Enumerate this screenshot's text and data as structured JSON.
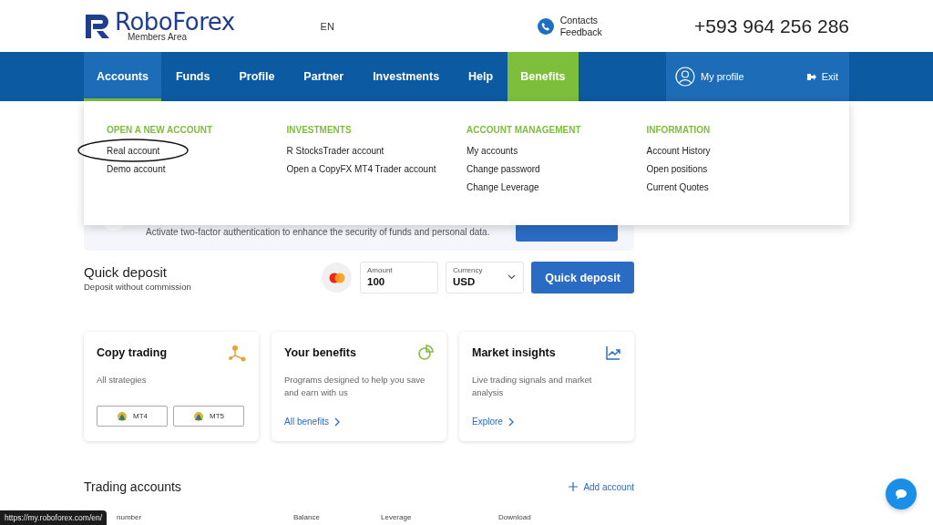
{
  "header": {
    "brand": "RoboForex",
    "subtitle": "Members Area",
    "language": "EN",
    "contacts": [
      "Contacts",
      "Feedback"
    ],
    "phone": "+593 964 256 286"
  },
  "nav": {
    "items": [
      {
        "label": "Accounts",
        "selected": true,
        "accent": false
      },
      {
        "label": "Funds",
        "selected": false,
        "accent": false
      },
      {
        "label": "Profile",
        "selected": false,
        "accent": false
      },
      {
        "label": "Partner",
        "selected": false,
        "accent": false
      },
      {
        "label": "Investments",
        "selected": false,
        "accent": false
      },
      {
        "label": "Help",
        "selected": false,
        "accent": false
      },
      {
        "label": "Benefits",
        "selected": false,
        "accent": true
      }
    ],
    "profile": "My profile",
    "exit": "Exit"
  },
  "dropdown": {
    "columns": [
      {
        "heading": "OPEN A NEW ACCOUNT",
        "links": [
          {
            "label": "Real account",
            "circled": true
          },
          {
            "label": "Demo account",
            "circled": false
          }
        ]
      },
      {
        "heading": "INVESTMENTS",
        "links": [
          {
            "label": "R StocksTrader account",
            "circled": false
          },
          {
            "label": "Open a CopyFX MT4 Trader account",
            "circled": false
          }
        ]
      },
      {
        "heading": "ACCOUNT MANAGEMENT",
        "links": [
          {
            "label": "My accounts",
            "circled": false
          },
          {
            "label": "Change password",
            "circled": false
          },
          {
            "label": "Change Leverage",
            "circled": false
          }
        ]
      },
      {
        "heading": "INFORMATION",
        "links": [
          {
            "label": "Account History",
            "circled": false
          },
          {
            "label": "Open positions",
            "circled": false
          },
          {
            "label": "Current Quotes",
            "circled": false
          }
        ]
      }
    ]
  },
  "security_banner": {
    "text": "Activate two-factor authentication to enhance the security of funds and personal data."
  },
  "quick_deposit": {
    "title": "Quick deposit",
    "subtitle": "Deposit without commission",
    "amount": {
      "label": "Amount",
      "value": "100"
    },
    "currency": {
      "label": "Currency",
      "value": "USD"
    },
    "button": "Quick deposit"
  },
  "cards": [
    {
      "kind": "copy",
      "title": "Copy trading",
      "text": "All strategies",
      "buttons": [
        "MT4",
        "MT5"
      ]
    },
    {
      "kind": "benefits",
      "title": "Your benefits",
      "text": "Programs designed to help you save and earn with us",
      "link": "All benefits"
    },
    {
      "kind": "insights",
      "title": "Market insights",
      "text": "Live trading signals and market analysis",
      "link": "Explore"
    }
  ],
  "trading_accounts": {
    "title": "Trading accounts",
    "add": "Add account",
    "columns": [
      "number",
      "Balance",
      "Leverage",
      "Download"
    ]
  },
  "status_url": "https://my.roboforex.com/en/"
}
